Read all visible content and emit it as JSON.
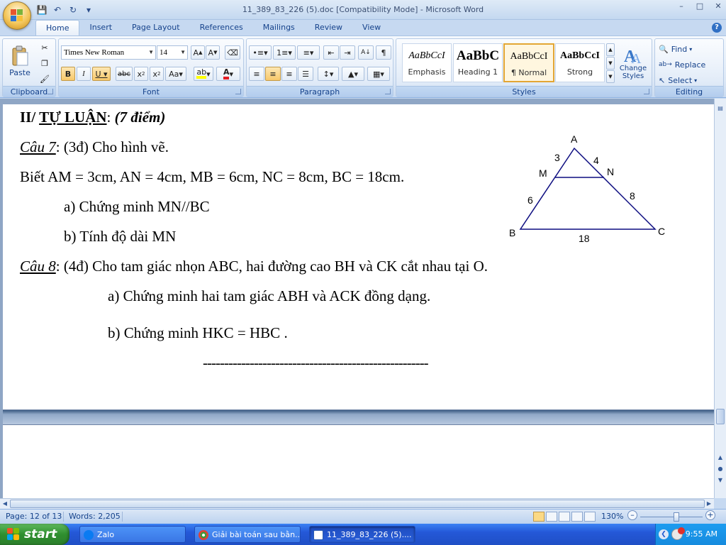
{
  "window": {
    "title": "11_389_83_226 (5).doc [Compatibility Mode] - Microsoft Word"
  },
  "tabs": [
    "Home",
    "Insert",
    "Page Layout",
    "References",
    "Mailings",
    "Review",
    "View"
  ],
  "ribbon": {
    "clipboard": {
      "label": "Clipboard",
      "paste": "Paste"
    },
    "font": {
      "label": "Font",
      "family": "Times New Roman",
      "size": "14"
    },
    "paragraph": {
      "label": "Paragraph"
    },
    "styles": {
      "label": "Styles",
      "items": [
        {
          "sample": "AaBbCcI",
          "name": "Emphasis"
        },
        {
          "sample": "AaBbC",
          "name": "Heading 1"
        },
        {
          "sample": "AaBbCcI",
          "name": "¶ Normal"
        },
        {
          "sample": "AaBbCcI",
          "name": "Strong"
        }
      ],
      "change_styles": "Change Styles"
    },
    "editing": {
      "label": "Editing",
      "find": "Find",
      "replace": "Replace",
      "select": "Select"
    }
  },
  "document": {
    "heading_prefix": "II/ ",
    "heading_main": "TỰ LUẬN",
    "heading_points": "(7 điểm)",
    "q7_label": "Câu 7",
    "q7_text": ": (3đ)   Cho hình vẽ.",
    "q7_given": "Biết AM = 3cm, AN = 4cm, MB = 6cm, NC = 8cm, BC = 18cm.",
    "q7_a": "a) Chứng minh MN//BC",
    "q7_b": "b) Tính độ dài MN",
    "q8_label": "Câu 8",
    "q8_text": ": (4đ)   Cho tam giác nhọn ABC, hai đường cao BH và CK cắt nhau tại O.",
    "q8_a": "a) Chứng minh hai tam giác ABH và ACK đồng dạng.",
    "q8_b_prefix": "b) Chứng minh ",
    "q8_b_math": "HKC = HBC",
    "q8_b_suffix": ".",
    "separator": "-----------------------------------------------------",
    "figure": {
      "labels": {
        "A": "A",
        "B": "B",
        "C": "C",
        "M": "M",
        "N": "N"
      },
      "segments": {
        "AM": "3",
        "AN": "4",
        "MB": "6",
        "NC": "8",
        "BC": "18"
      }
    }
  },
  "status": {
    "page": "Page: 12 of 13",
    "words": "Words: 2,205",
    "zoom": "130%"
  },
  "taskbar": {
    "start": "start",
    "tasks": [
      "Zalo",
      "Giải bài toán sau bằn...",
      "11_389_83_226 (5)...."
    ],
    "clock": "9:55 AM"
  }
}
